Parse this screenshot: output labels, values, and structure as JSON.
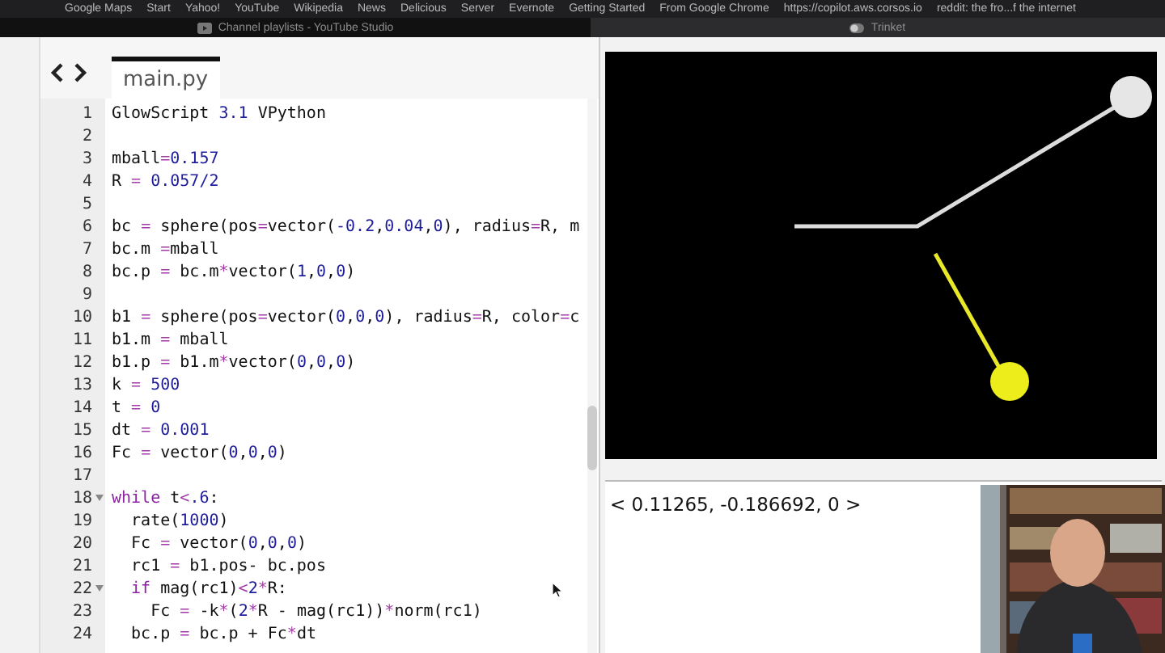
{
  "browser": {
    "bookmarks": [
      "Google Maps",
      "Start",
      "Yahoo!",
      "YouTube",
      "Wikipedia",
      "News",
      "Delicious",
      "Server",
      "Evernote",
      "Getting Started",
      "From Google Chrome",
      "https://copilot.aws.corsos.io",
      "reddit: the fro...f the internet"
    ],
    "tabs": [
      {
        "title": "Channel playlists - YouTube Studio",
        "selected": false
      },
      {
        "title": "Trinket",
        "selected": true
      }
    ]
  },
  "editor": {
    "file_tab": {
      "label": "main.py",
      "selected": true
    },
    "lines": [
      {
        "number": "1",
        "foldable": false,
        "tokens": [
          {
            "kind": "plain",
            "text": "GlowScript "
          },
          {
            "kind": "num",
            "text": "3.1"
          },
          {
            "kind": "plain",
            "text": " VPython"
          }
        ]
      },
      {
        "number": "2",
        "foldable": false
      },
      {
        "number": "3",
        "foldable": false,
        "tokens": [
          {
            "kind": "plain",
            "text": "mball"
          },
          {
            "kind": "op",
            "text": "="
          },
          {
            "kind": "num",
            "text": "0.157"
          }
        ]
      },
      {
        "number": "4",
        "foldable": false,
        "tokens": [
          {
            "kind": "plain",
            "text": "R "
          },
          {
            "kind": "op",
            "text": "="
          },
          {
            "kind": "num",
            "text": " 0.057/2"
          }
        ]
      },
      {
        "number": "5",
        "foldable": false
      },
      {
        "number": "6",
        "foldable": false,
        "tokens": [
          {
            "kind": "plain",
            "text": "bc "
          },
          {
            "kind": "op",
            "text": "="
          },
          {
            "kind": "plain",
            "text": " sphere(pos"
          },
          {
            "kind": "op",
            "text": "="
          },
          {
            "kind": "plain",
            "text": "vector("
          },
          {
            "kind": "num",
            "text": "-0.2"
          },
          {
            "kind": "plain",
            "text": ","
          },
          {
            "kind": "num",
            "text": "0.04"
          },
          {
            "kind": "plain",
            "text": ","
          },
          {
            "kind": "num",
            "text": "0"
          },
          {
            "kind": "plain",
            "text": "), radius"
          },
          {
            "kind": "op",
            "text": "="
          },
          {
            "kind": "plain",
            "text": "R, m"
          }
        ]
      },
      {
        "number": "7",
        "foldable": false,
        "tokens": [
          {
            "kind": "plain",
            "text": "bc.m "
          },
          {
            "kind": "op",
            "text": "="
          },
          {
            "kind": "plain",
            "text": "mball"
          }
        ]
      },
      {
        "number": "8",
        "foldable": false,
        "tokens": [
          {
            "kind": "plain",
            "text": "bc.p "
          },
          {
            "kind": "op",
            "text": "="
          },
          {
            "kind": "plain",
            "text": " bc.m"
          },
          {
            "kind": "op",
            "text": "*"
          },
          {
            "kind": "plain",
            "text": "vector("
          },
          {
            "kind": "num",
            "text": "1"
          },
          {
            "kind": "plain",
            "text": ","
          },
          {
            "kind": "num",
            "text": "0"
          },
          {
            "kind": "plain",
            "text": ","
          },
          {
            "kind": "num",
            "text": "0"
          },
          {
            "kind": "plain",
            "text": ")"
          }
        ]
      },
      {
        "number": "9",
        "foldable": false
      },
      {
        "number": "10",
        "foldable": false,
        "tokens": [
          {
            "kind": "plain",
            "text": "b1 "
          },
          {
            "kind": "op",
            "text": "="
          },
          {
            "kind": "plain",
            "text": " sphere(pos"
          },
          {
            "kind": "op",
            "text": "="
          },
          {
            "kind": "plain",
            "text": "vector("
          },
          {
            "kind": "num",
            "text": "0"
          },
          {
            "kind": "plain",
            "text": ","
          },
          {
            "kind": "num",
            "text": "0"
          },
          {
            "kind": "plain",
            "text": ","
          },
          {
            "kind": "num",
            "text": "0"
          },
          {
            "kind": "plain",
            "text": "), radius"
          },
          {
            "kind": "op",
            "text": "="
          },
          {
            "kind": "plain",
            "text": "R, color"
          },
          {
            "kind": "op",
            "text": "="
          },
          {
            "kind": "plain",
            "text": "c"
          }
        ]
      },
      {
        "number": "11",
        "foldable": false,
        "tokens": [
          {
            "kind": "plain",
            "text": "b1.m "
          },
          {
            "kind": "op",
            "text": "="
          },
          {
            "kind": "plain",
            "text": " mball"
          }
        ]
      },
      {
        "number": "12",
        "foldable": false,
        "tokens": [
          {
            "kind": "plain",
            "text": "b1.p "
          },
          {
            "kind": "op",
            "text": "="
          },
          {
            "kind": "plain",
            "text": " b1.m"
          },
          {
            "kind": "op",
            "text": "*"
          },
          {
            "kind": "plain",
            "text": "vector("
          },
          {
            "kind": "num",
            "text": "0"
          },
          {
            "kind": "plain",
            "text": ","
          },
          {
            "kind": "num",
            "text": "0"
          },
          {
            "kind": "plain",
            "text": ","
          },
          {
            "kind": "num",
            "text": "0"
          },
          {
            "kind": "plain",
            "text": ")"
          }
        ]
      },
      {
        "number": "13",
        "foldable": false,
        "tokens": [
          {
            "kind": "plain",
            "text": "k "
          },
          {
            "kind": "op",
            "text": "="
          },
          {
            "kind": "num",
            "text": " 500"
          }
        ]
      },
      {
        "number": "14",
        "foldable": false,
        "tokens": [
          {
            "kind": "plain",
            "text": "t "
          },
          {
            "kind": "op",
            "text": "="
          },
          {
            "kind": "num",
            "text": " 0"
          }
        ]
      },
      {
        "number": "15",
        "foldable": false,
        "tokens": [
          {
            "kind": "plain",
            "text": "dt "
          },
          {
            "kind": "op",
            "text": "="
          },
          {
            "kind": "num",
            "text": " 0.001"
          }
        ]
      },
      {
        "number": "16",
        "foldable": false,
        "tokens": [
          {
            "kind": "plain",
            "text": "Fc "
          },
          {
            "kind": "op",
            "text": "="
          },
          {
            "kind": "plain",
            "text": " vector("
          },
          {
            "kind": "num",
            "text": "0"
          },
          {
            "kind": "plain",
            "text": ","
          },
          {
            "kind": "num",
            "text": "0"
          },
          {
            "kind": "plain",
            "text": ","
          },
          {
            "kind": "num",
            "text": "0"
          },
          {
            "kind": "plain",
            "text": ")"
          }
        ]
      },
      {
        "number": "17",
        "foldable": false
      },
      {
        "number": "18",
        "foldable": true,
        "tokens": [
          {
            "kind": "kw",
            "text": "while"
          },
          {
            "kind": "plain",
            "text": " t"
          },
          {
            "kind": "op",
            "text": "<"
          },
          {
            "kind": "num",
            "text": ".6"
          },
          {
            "kind": "plain",
            "text": ":"
          }
        ]
      },
      {
        "number": "19",
        "foldable": false,
        "tokens": [
          {
            "kind": "plain",
            "text": "  rate("
          },
          {
            "kind": "num",
            "text": "1000"
          },
          {
            "kind": "plain",
            "text": ")"
          }
        ]
      },
      {
        "number": "20",
        "foldable": false,
        "tokens": [
          {
            "kind": "plain",
            "text": "  Fc "
          },
          {
            "kind": "op",
            "text": "="
          },
          {
            "kind": "plain",
            "text": " vector("
          },
          {
            "kind": "num",
            "text": "0"
          },
          {
            "kind": "plain",
            "text": ","
          },
          {
            "kind": "num",
            "text": "0"
          },
          {
            "kind": "plain",
            "text": ","
          },
          {
            "kind": "num",
            "text": "0"
          },
          {
            "kind": "plain",
            "text": ")"
          }
        ]
      },
      {
        "number": "21",
        "foldable": false,
        "tokens": [
          {
            "kind": "plain",
            "text": "  rc1 "
          },
          {
            "kind": "op",
            "text": "="
          },
          {
            "kind": "plain",
            "text": " b1.pos- bc.pos"
          }
        ]
      },
      {
        "number": "22",
        "foldable": true,
        "tokens": [
          {
            "kind": "kw",
            "text": "  if"
          },
          {
            "kind": "plain",
            "text": " mag(rc1)"
          },
          {
            "kind": "op",
            "text": "<"
          },
          {
            "kind": "num",
            "text": "2"
          },
          {
            "kind": "op",
            "text": "*"
          },
          {
            "kind": "plain",
            "text": "R:"
          }
        ]
      },
      {
        "number": "23",
        "foldable": false,
        "tokens": [
          {
            "kind": "plain",
            "text": "    Fc "
          },
          {
            "kind": "op",
            "text": "="
          },
          {
            "kind": "plain",
            "text": " -k"
          },
          {
            "kind": "op",
            "text": "*"
          },
          {
            "kind": "plain",
            "text": "("
          },
          {
            "kind": "num",
            "text": "2"
          },
          {
            "kind": "op",
            "text": "*"
          },
          {
            "kind": "plain",
            "text": "R - mag(rc1))"
          },
          {
            "kind": "op",
            "text": "*"
          },
          {
            "kind": "plain",
            "text": "norm(rc1)"
          }
        ]
      },
      {
        "number": "24",
        "foldable": false,
        "tokens": [
          {
            "kind": "plain",
            "text": "  bc.p "
          },
          {
            "kind": "op",
            "text": "="
          },
          {
            "kind": "plain",
            "text": " bc.p + Fc"
          },
          {
            "kind": "op",
            "text": "*"
          },
          {
            "kind": "plain",
            "text": "dt"
          }
        ]
      }
    ]
  },
  "output": {
    "text": "< 0.11265, -0.186692, 0 >"
  }
}
